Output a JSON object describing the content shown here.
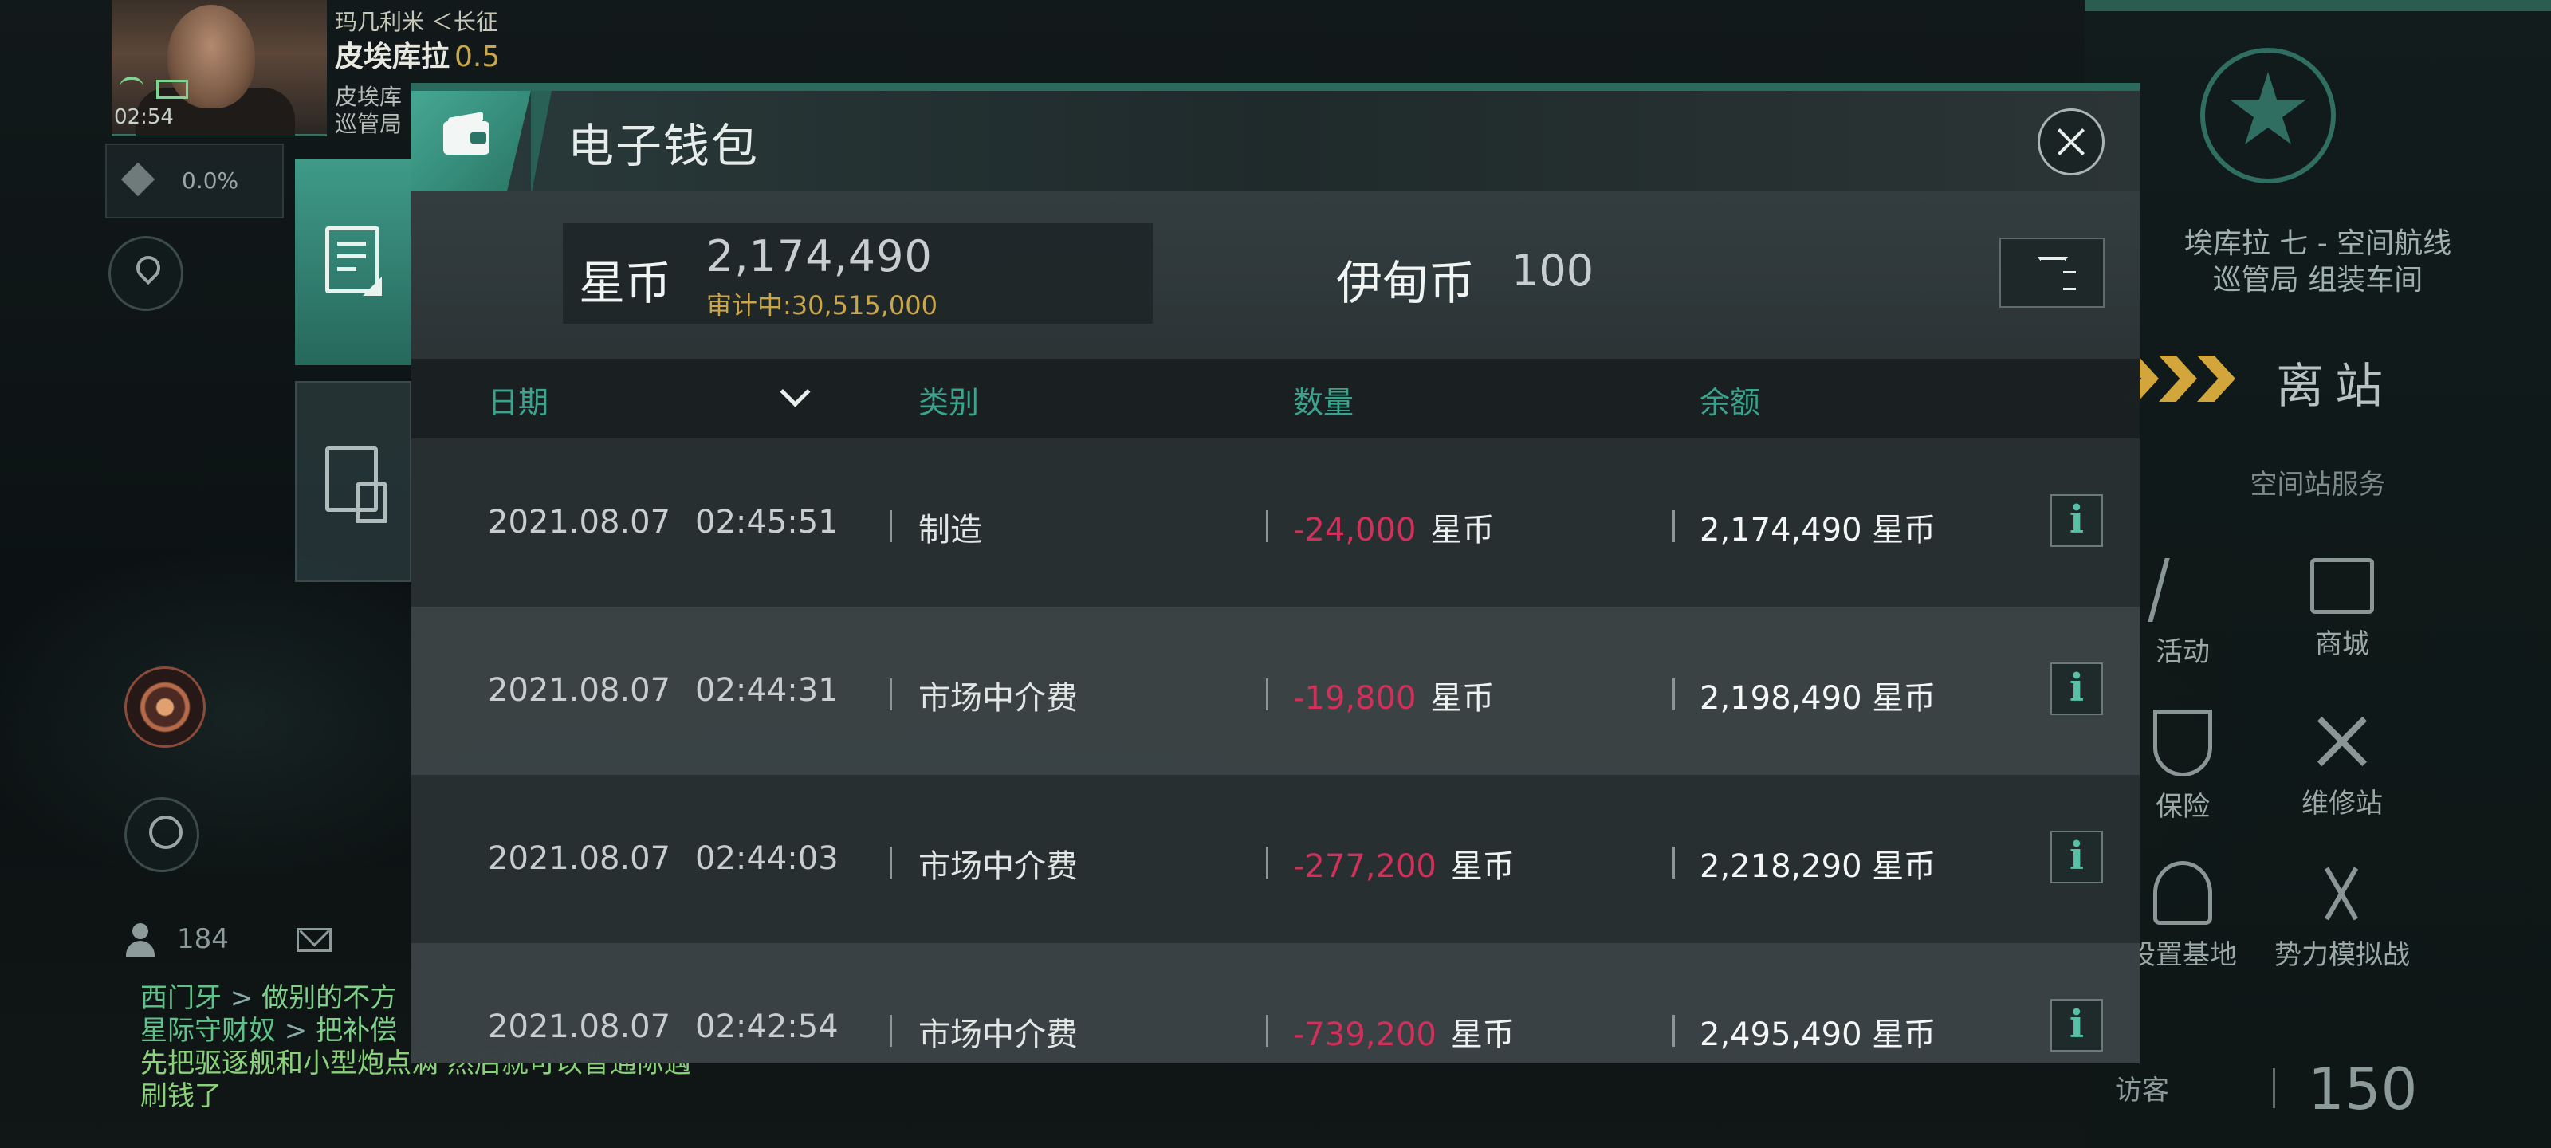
{
  "hud": {
    "corp": "玛几利米 ＜长征",
    "pilot_name": "皮埃库拉",
    "pilot_security": "0.5",
    "location_line1": "皮埃库",
    "location_line2": "巡管局",
    "clock": "02:54",
    "cargo_percent": "0.0%",
    "member_count": "184"
  },
  "chat": [
    {
      "speaker": "西门牙",
      "message": "做别的不方"
    },
    {
      "speaker": "星际守财奴",
      "message": "把补偿"
    },
    {
      "plain": "先把驱逐舰和小型炮点满 然后就可以普通际遇"
    },
    {
      "plain": "刷钱了"
    }
  ],
  "wallet": {
    "title": "电子钱包",
    "star_coin_label": "星币",
    "star_coin_value": "2,174,490",
    "star_coin_escrow": "审计中:30,515,000",
    "eden_coin_label": "伊甸币",
    "eden_coin_value": "100",
    "columns": {
      "date": "日期",
      "type": "类别",
      "amount": "数量",
      "balance": "余额"
    },
    "rows": [
      {
        "date": "2021.08.07",
        "time": "02:45:51",
        "type": "制造",
        "amount": "-24,000",
        "amount_currency": "星币",
        "balance": "2,174,490 星币"
      },
      {
        "date": "2021.08.07",
        "time": "02:44:31",
        "type": "市场中介费",
        "amount": "-19,800",
        "amount_currency": "星币",
        "balance": "2,198,490 星币"
      },
      {
        "date": "2021.08.07",
        "time": "02:44:03",
        "type": "市场中介费",
        "amount": "-277,200",
        "amount_currency": "星币",
        "balance": "2,218,290 星币"
      },
      {
        "date": "2021.08.07",
        "time": "02:42:54",
        "type": "市场中介费",
        "amount": "-739,200",
        "amount_currency": "星币",
        "balance": "2,495,490 星币"
      }
    ],
    "info_glyph": "i"
  },
  "station": {
    "name_line1": "埃库拉 七 - 空间航线",
    "name_line2": "巡管局 组装车间",
    "undock_label": "离站",
    "services_title": "空间站服务",
    "services": [
      {
        "label": "活动",
        "icon": "party-popper-icon"
      },
      {
        "label": "商城",
        "icon": "shop-icon"
      },
      {
        "label": "保险",
        "icon": "insurance-shield-icon"
      },
      {
        "label": "维修站",
        "icon": "repair-tools-icon"
      },
      {
        "label": "设置基地",
        "icon": "set-base-icon"
      },
      {
        "label": "势力模拟战",
        "icon": "crossed-flags-icon"
      }
    ],
    "visitor_label": "访客",
    "visitor_count": "150"
  },
  "colors": {
    "accent": "#3aa38e",
    "negative_amount": "#d0305a",
    "escrow": "#c9a64a",
    "undock_chevron": "#d3a63c"
  }
}
